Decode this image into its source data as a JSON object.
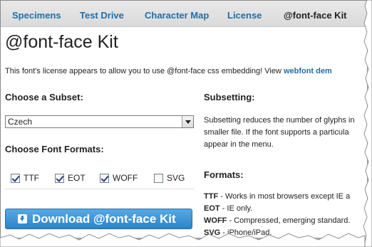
{
  "tabs": [
    {
      "label": "Specimens",
      "active": false
    },
    {
      "label": "Test Drive",
      "active": false
    },
    {
      "label": "Character Map",
      "active": false
    },
    {
      "label": "License",
      "active": false
    },
    {
      "label": "@font-face Kit",
      "active": true
    }
  ],
  "page_title": "@font-face Kit",
  "license": {
    "text": "This font's license appears to allow you to use @font-face css embedding! View ",
    "link": "webfont dem"
  },
  "subset": {
    "heading": "Choose a Subset:",
    "selected": "Czech"
  },
  "formats_left": {
    "heading": "Choose Font Formats:",
    "options": [
      {
        "label": "TTF",
        "checked": true
      },
      {
        "label": "EOT",
        "checked": true
      },
      {
        "label": "WOFF",
        "checked": true
      },
      {
        "label": "SVG",
        "checked": false
      }
    ]
  },
  "download_button": "Download @font-face Kit",
  "subsetting": {
    "heading": "Subsetting:",
    "lines": [
      "Subsetting reduces the number of glyphs in",
      "smaller file. If the font supports a particula",
      "appear in the menu."
    ]
  },
  "formats_right": {
    "heading": "Formats:",
    "items": [
      {
        "name": "TTF",
        "desc": " - Works in most browsers except IE a"
      },
      {
        "name": "EOT",
        "desc": " - IE only."
      },
      {
        "name": "WOFF",
        "desc": " - Compressed, emerging standard."
      },
      {
        "name": "SVG",
        "desc": " - iPhone/iPad."
      }
    ]
  },
  "colors": {
    "link": "#1f6fa8",
    "button": "#2d84c8",
    "tabbar": "#dadada"
  }
}
